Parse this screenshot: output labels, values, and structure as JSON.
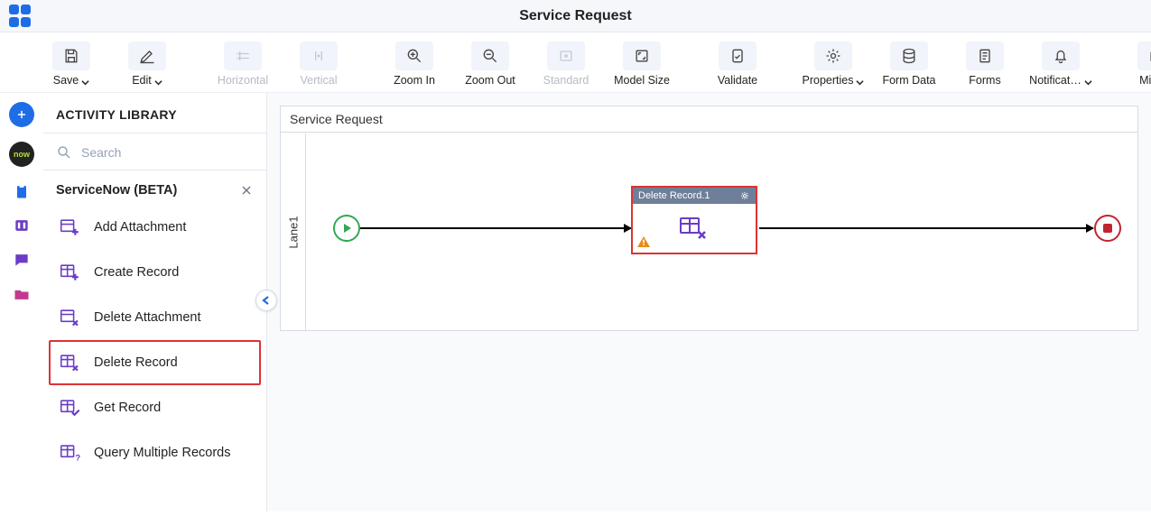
{
  "header": {
    "title": "Service Request"
  },
  "toolbar": {
    "save": "Save",
    "edit": "Edit",
    "horizontal": "Horizontal",
    "vertical": "Vertical",
    "zoom_in": "Zoom In",
    "zoom_out": "Zoom Out",
    "standard": "Standard",
    "model_size": "Model Size",
    "validate": "Validate",
    "properties": "Properties",
    "form_data": "Form Data",
    "forms": "Forms",
    "notifications": "Notificat…",
    "misc": "Misc"
  },
  "panel": {
    "heading": "ACTIVITY LIBRARY",
    "search_placeholder": "Search",
    "group_name": "ServiceNow (BETA)",
    "items": [
      {
        "label": "Add Attachment"
      },
      {
        "label": "Create Record"
      },
      {
        "label": "Delete Attachment"
      },
      {
        "label": "Delete Record"
      },
      {
        "label": "Get Record"
      },
      {
        "label": "Query Multiple Records"
      }
    ]
  },
  "canvas": {
    "title": "Service Request",
    "lane_label": "Lane1",
    "node_title": "Delete Record.1"
  }
}
